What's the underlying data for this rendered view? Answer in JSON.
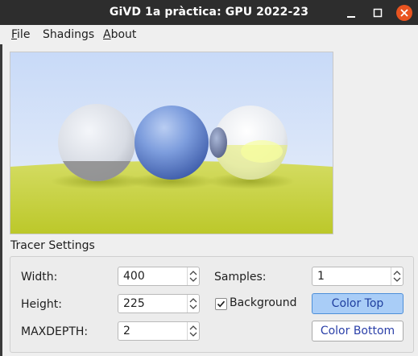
{
  "window": {
    "title": "GiVD 1a pràctica: GPU 2022-23",
    "minimize_icon": "minimize-icon",
    "maximize_icon": "maximize-icon",
    "close_icon": "close-icon",
    "close_color": "#e95420"
  },
  "menubar": {
    "file_mnemonic": "F",
    "file_rest": "ile",
    "shadings": "Shadings",
    "about_mnemonic": "A",
    "about_rest": "bout"
  },
  "render": {
    "width": 400,
    "height": 225,
    "sky_color": "#d7e3f7",
    "ground_color": "#c9d437"
  },
  "tracer": {
    "group_title": "Tracer Settings",
    "width_label": "Width:",
    "width_value": "400",
    "height_label": "Height:",
    "height_value": "225",
    "maxdepth_label": "MAXDEPTH:",
    "maxdepth_value": "2",
    "samples_label": "Samples:",
    "samples_value": "1",
    "background_label": "Background",
    "background_checked": true,
    "color_top_label": "Color Top",
    "color_bottom_label": "Color Bottom",
    "accent_color": "#a9cdf7"
  }
}
